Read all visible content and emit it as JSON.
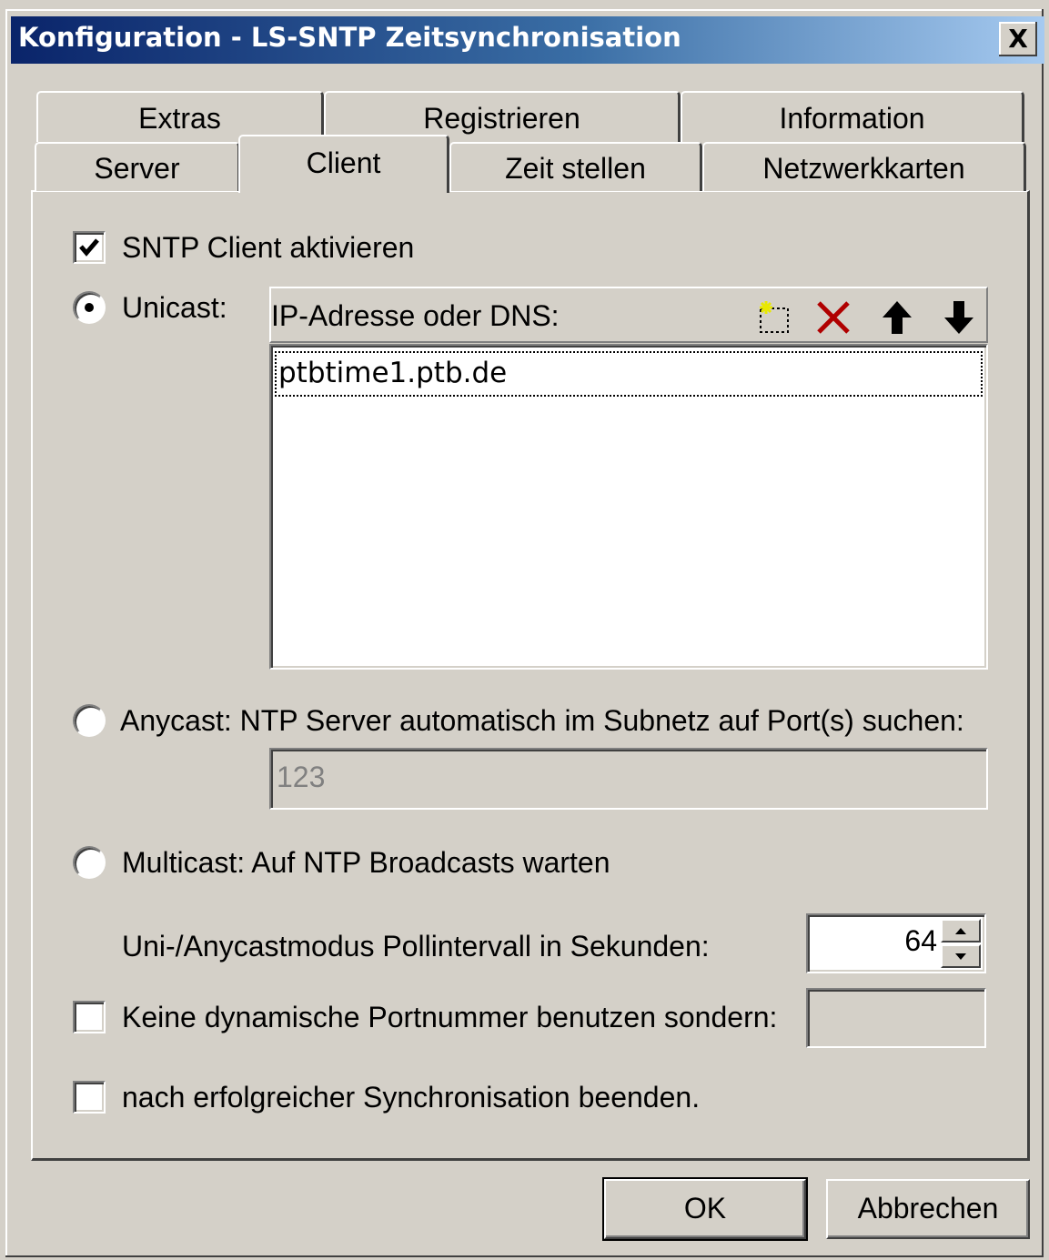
{
  "window": {
    "title": "Konfiguration - LS-SNTP Zeitsynchronisation",
    "close_label": "X"
  },
  "tabs_row1": [
    {
      "label": "Extras"
    },
    {
      "label": "Registrieren"
    },
    {
      "label": "Information"
    }
  ],
  "tabs_row2": [
    {
      "label": "Server"
    },
    {
      "label": "Client",
      "active": true
    },
    {
      "label": "Zeit stellen"
    },
    {
      "label": "Netzwerkkarten"
    }
  ],
  "client": {
    "enable_checkbox": {
      "label": "SNTP Client aktivieren",
      "checked": true
    },
    "unicast": {
      "label": "Unicast:",
      "selected": true,
      "list_header": "IP-Adresse oder DNS:",
      "toolbar_icons": [
        "new-entry-icon",
        "delete-icon",
        "move-up-icon",
        "move-down-icon"
      ],
      "entries": [
        "ptbtime1.ptb.de"
      ]
    },
    "anycast": {
      "label": "Anycast: NTP Server automatisch im Subnetz auf Port(s) suchen:",
      "selected": false,
      "ports_value": "123"
    },
    "multicast": {
      "label": "Multicast: Auf NTP Broadcasts warten",
      "selected": false
    },
    "poll_interval": {
      "label": "Uni-/Anycastmodus Pollintervall in Sekunden:",
      "value": "64"
    },
    "static_port": {
      "label": "Keine dynamische Portnummer benutzen sondern:",
      "checked": false,
      "value": ""
    },
    "exit_after_sync": {
      "label": "nach erfolgreicher Synchronisation beenden.",
      "checked": false
    }
  },
  "buttons": {
    "ok": "OK",
    "cancel": "Abbrechen"
  },
  "colors": {
    "title_start": "#0a246a",
    "title_end": "#a6caf0",
    "face": "#d4d0c8",
    "delete_red": "#b00000"
  }
}
